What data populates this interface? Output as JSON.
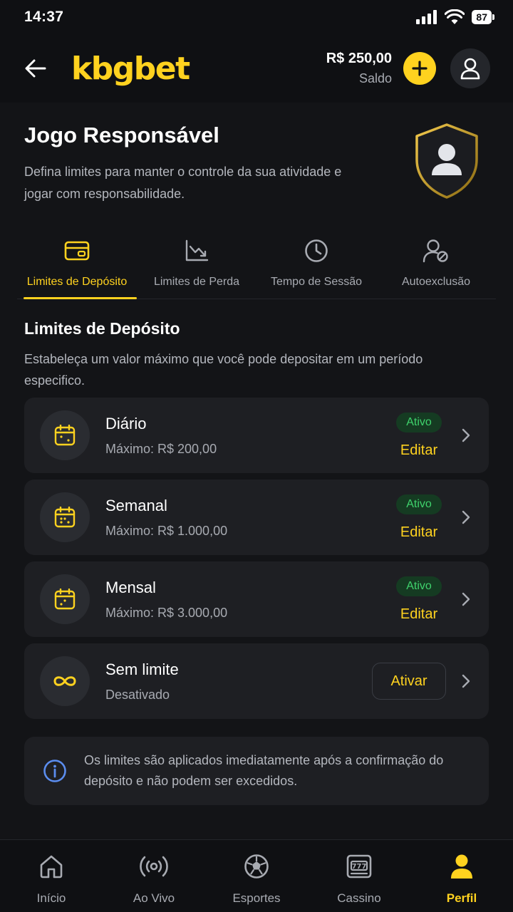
{
  "status_bar": {
    "time": "14:37",
    "battery": "87"
  },
  "header": {
    "logo": "kbgbet",
    "balance_amount": "R$ 250,00",
    "balance_label": "Saldo"
  },
  "hero": {
    "title": "Jogo Responsável",
    "description": "Defina limites para manter o controle da sua atividade e jogar com responsabilidade."
  },
  "tabs": [
    {
      "label": "Limites de Depósito",
      "icon": "wallet-icon",
      "active": true
    },
    {
      "label": "Limites de Perda",
      "icon": "trend-down-icon",
      "active": false
    },
    {
      "label": "Tempo de Sessão",
      "icon": "clock-icon",
      "active": false
    },
    {
      "label": "Autoexclusão",
      "icon": "user-block-icon",
      "active": false
    }
  ],
  "section": {
    "title": "Limites de Depósito",
    "description": "Estabeleça um valor máximo que você pode depositar em um período especifico."
  },
  "limits": [
    {
      "title": "Diário",
      "subtitle": "Máximo: R$ 200,00",
      "status": "Ativo",
      "action": "Editar",
      "icon": "calendar-icon"
    },
    {
      "title": "Semanal",
      "subtitle": "Máximo: R$ 1.000,00",
      "status": "Ativo",
      "action": "Editar",
      "icon": "calendar-icon"
    },
    {
      "title": "Mensal",
      "subtitle": "Máximo: R$ 3.000,00",
      "status": "Ativo",
      "action": "Editar",
      "icon": "calendar-icon"
    },
    {
      "title": "Sem limite",
      "subtitle": "Desativado",
      "action": "Ativar",
      "icon": "infinity-icon"
    }
  ],
  "info": {
    "text": "Os limites são aplicados imediatamente após a confirmação do depósito e não podem ser excedidos."
  },
  "nav": [
    {
      "label": "Início",
      "icon": "home-icon",
      "active": false
    },
    {
      "label": "Ao Vivo",
      "icon": "live-broadcast-icon",
      "active": false
    },
    {
      "label": "Esportes",
      "icon": "soccer-ball-icon",
      "active": false
    },
    {
      "label": "Cassino",
      "icon": "slot-machine-icon",
      "active": false
    },
    {
      "label": "Perfil",
      "icon": "user-icon",
      "active": true
    }
  ],
  "colors": {
    "accent": "#ffd21f",
    "background": "#131417",
    "card": "#1e1f23",
    "success": "#3fd26c",
    "info": "#5b8def"
  }
}
